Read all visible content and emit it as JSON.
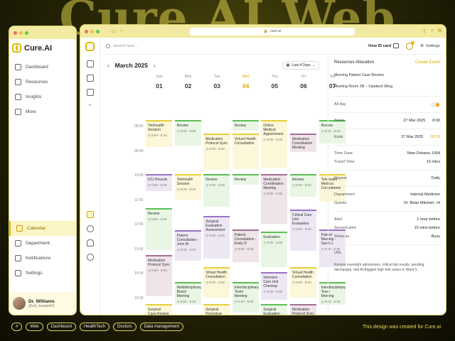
{
  "bg_title": "Cure AI Web",
  "browser": {
    "url": "cure.ai"
  },
  "app": {
    "name": "Cure.AI"
  },
  "sidebar": {
    "items": [
      {
        "label": "Dashboard",
        "icon": "grid-icon"
      },
      {
        "label": "Resources",
        "icon": "folder-icon"
      },
      {
        "label": "Insights",
        "icon": "chart-icon"
      },
      {
        "label": "More",
        "icon": "sparkle-icon"
      }
    ],
    "bottom_items": [
      {
        "label": "Calendar",
        "icon": "calendar-icon",
        "active": true
      },
      {
        "label": "Department",
        "icon": "people-icon"
      },
      {
        "label": "Notifications",
        "icon": "bell-icon"
      },
      {
        "label": "Settings",
        "icon": "gear-icon"
      }
    ]
  },
  "user": {
    "name": "Dr. Williams",
    "handle": "@wil_manipal01"
  },
  "topbar": {
    "search_placeholder": "Search here...",
    "view_id": "View ID card",
    "notif_count": "3",
    "settings": "Settings"
  },
  "calendar": {
    "month": "March 2025",
    "range": "Last 4 Days",
    "days": [
      {
        "dow": "Sun",
        "num": "01"
      },
      {
        "dow": "Mon",
        "num": "02"
      },
      {
        "dow": "Tue",
        "num": "03"
      },
      {
        "dow": "Wed",
        "num": "04",
        "today": true
      },
      {
        "dow": "Thu",
        "num": "05"
      },
      {
        "dow": "Fri",
        "num": "06"
      },
      {
        "dow": "Sat",
        "num": "07"
      }
    ],
    "times": [
      "08:00",
      "09:00",
      "10:00",
      "11:00",
      "12:00",
      "13:00",
      "14:00",
      "15:00"
    ],
    "events": [
      {
        "day": 0,
        "slot": 0.0,
        "len": 1.15,
        "title": "Telehealth Session",
        "time": "8:00 - 8:30",
        "color": "yellow"
      },
      {
        "day": 0,
        "slot": 2.2,
        "len": 0.75,
        "title": "ICU Rounds",
        "time": "8:00 - 8:30",
        "color": "purple"
      },
      {
        "day": 0,
        "slot": 3.6,
        "len": 1.75,
        "title": "Review",
        "time": "8:00 - 8:30",
        "color": "green"
      },
      {
        "day": 0,
        "slot": 5.5,
        "len": 1.75,
        "title": "Medication Protocol Sync",
        "time": "8:00 - 8:30",
        "color": "mauve"
      },
      {
        "day": 0,
        "slot": 7.5,
        "len": 0.7,
        "title": "Surgical Case Review",
        "time": "8:00 - 8:30",
        "color": "yellow"
      },
      {
        "day": 1,
        "slot": 0.0,
        "len": 1.1,
        "title": "Review",
        "time": "8:00 - 8:30",
        "color": "green"
      },
      {
        "day": 1,
        "slot": 2.2,
        "len": 1.1,
        "title": "Telehealth Session",
        "time": "8:00 - 8:30",
        "color": "yellow"
      },
      {
        "day": 1,
        "slot": 4.5,
        "len": 1.3,
        "title": "Patient Consultation - John M",
        "time": "8:00 - 8:30",
        "color": "purple"
      },
      {
        "day": 1,
        "slot": 6.6,
        "len": 1.0,
        "title": "Multidisciplinary Board Meeting",
        "time": "8:00 - 8:30",
        "color": "green"
      },
      {
        "day": 2,
        "slot": 0.55,
        "len": 1.55,
        "title": "Medication Protocol Sync",
        "time": "8:00 - 8:30",
        "color": "yellow"
      },
      {
        "day": 2,
        "slot": 2.2,
        "len": 1.4,
        "title": "Review",
        "time": "8:00 - 8:30",
        "color": "green"
      },
      {
        "day": 2,
        "slot": 3.9,
        "len": 1.8,
        "title": "Surgical Evaluation Assessment",
        "time": "8:00 - 8:30",
        "color": "purple"
      },
      {
        "day": 2,
        "slot": 6.0,
        "len": 1.3,
        "title": "Virtual Health Consultation",
        "time": "8:00 - 8:30",
        "color": "yellow"
      },
      {
        "day": 2,
        "slot": 7.5,
        "len": 0.7,
        "title": "Surgical Procedure Assessment",
        "time": "8:00 - 8:30",
        "color": "yellow"
      },
      {
        "day": 3,
        "slot": 0.0,
        "len": 0.5,
        "title": "Review",
        "time": "",
        "color": "green"
      },
      {
        "day": 3,
        "slot": 0.55,
        "len": 1.5,
        "title": "Virtual Health Consultation",
        "time": "",
        "color": "yellow"
      },
      {
        "day": 3,
        "slot": 2.2,
        "len": 0.5,
        "title": "Review",
        "time": "",
        "color": "green"
      },
      {
        "day": 3,
        "slot": 4.45,
        "len": 1.4,
        "title": "Patient Consultation - Emily R",
        "time": "8:00 - 8:30",
        "color": "mauve"
      },
      {
        "day": 3,
        "slot": 6.6,
        "len": 1.3,
        "title": "Interdisciplinary Team Meeting",
        "time": "8:00 - 8:30",
        "color": "green"
      },
      {
        "day": 4,
        "slot": 0.0,
        "len": 2.0,
        "title": "Online Medical Appointment",
        "time": "8:00 - 8:30",
        "color": "yellow"
      },
      {
        "day": 4,
        "slot": 2.2,
        "len": 2.1,
        "title": "Medication Coordination Meeting",
        "time": "8:00 - 8:30",
        "color": "mauve"
      },
      {
        "day": 4,
        "slot": 4.55,
        "len": 1.5,
        "title": "Evaluation",
        "time": "8:00 - 8:30",
        "color": "green"
      },
      {
        "day": 4,
        "slot": 6.2,
        "len": 1.2,
        "title": "Intensive Care Unit Checkup",
        "time": "8:00 - 8:30",
        "color": "purple"
      },
      {
        "day": 4,
        "slot": 7.5,
        "len": 0.7,
        "title": "Surgical Evaluation Review",
        "time": "8:00 - 8:30",
        "color": "green"
      },
      {
        "day": 5,
        "slot": 0.55,
        "len": 0.8,
        "title": "Medication Coordination Meeting",
        "time": "",
        "color": "mauve"
      },
      {
        "day": 5,
        "slot": 2.2,
        "len": 1.0,
        "title": "Review",
        "time": "8:00 - 8:30",
        "color": "green"
      },
      {
        "day": 5,
        "slot": 3.65,
        "len": 1.75,
        "title": "Critical Care Unit Evaluation",
        "time": "8:00 - 8:30",
        "color": "purple"
      },
      {
        "day": 5,
        "slot": 6.0,
        "len": 1.3,
        "title": "Virtual Health Consultation",
        "time": "8:00 - 8:30",
        "color": "yellow"
      },
      {
        "day": 5,
        "slot": 7.5,
        "len": 0.7,
        "title": "Medication Protocol Sync",
        "time": "8:00 - 8:30",
        "color": "mauve"
      },
      {
        "day": 6,
        "slot": 0.0,
        "len": 1.0,
        "title": "Review",
        "time": "8:00 - 8:30",
        "color": "green"
      },
      {
        "day": 6,
        "slot": 2.2,
        "len": 1.2,
        "title": "Telehealth Medical Consultation",
        "time": "",
        "color": "yellow"
      },
      {
        "day": 6,
        "slot": 4.45,
        "len": 1.6,
        "title": "Patient Meeting - Sarah L",
        "time": "8:00 - 8:30",
        "color": "purple"
      },
      {
        "day": 6,
        "slot": 6.6,
        "len": 1.0,
        "title": "Interdisciplinary Team Meeting",
        "time": "8:00 - 8:30",
        "color": "green"
      }
    ]
  },
  "resources": {
    "title": "Resources Allocation",
    "create": "Create Event",
    "event_title": "Morning Patient Case Review",
    "location": "Meeting Room 2B – Inpatient Wing",
    "allday": "All day",
    "starts_label": "Starts",
    "starts_date": "27 Mar 2025",
    "starts_time": "8:00",
    "ends_label": "Ends",
    "ends_date": "27 Mar 2025",
    "ends_time": "09:20",
    "timezone_label": "Time Zone",
    "timezone": "New Orleans, USA",
    "travel_label": "Travel Time",
    "travel": "10 mins",
    "repeat_label": "Repeat",
    "repeat": "Daily",
    "dept_label": "Department",
    "dept": "Internal Medicine",
    "guests_label": "Guests",
    "guests": "Dr. Brian Mitchell, +4",
    "alert_label": "Alert",
    "alert": "1 hour before",
    "second_label": "Second alert",
    "second": "15 mins before",
    "show_label": "Show as",
    "show": "Busy",
    "url_label": "URL",
    "description": "Review overnight admissions, critical lab results, pending discharges, and AI-flagged high-risk cases in Ward 5."
  },
  "footer": {
    "tags": [
      "#",
      "Web",
      "Dashboard",
      "HealthTech",
      "Doctors",
      "Data management"
    ],
    "note": "This design was created for Cure.ai"
  }
}
